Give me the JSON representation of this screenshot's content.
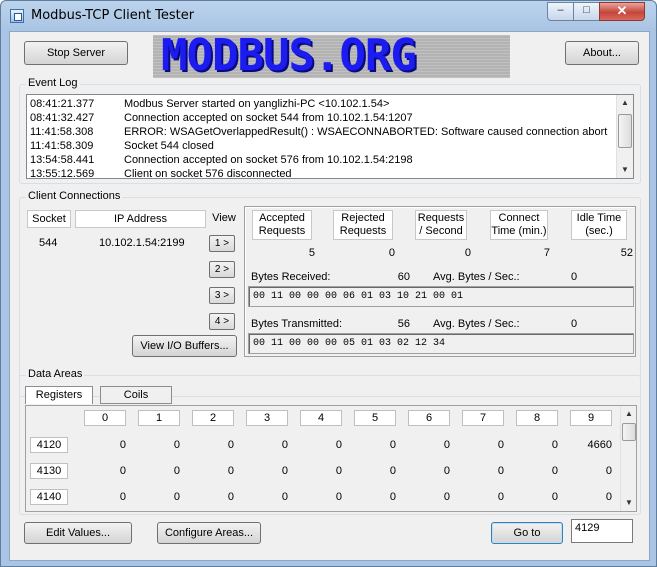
{
  "window": {
    "title": "Modbus-TCP Client Tester",
    "controls": {
      "minimize": "–",
      "maximize": "□",
      "close": "✕"
    }
  },
  "toolbar": {
    "stop_server": "Stop Server",
    "about": "About...",
    "logo_text": "MODBUS.ORG"
  },
  "event_log": {
    "label": "Event Log",
    "entries": [
      {
        "time": "08:41:21.377",
        "message": "Modbus Server started on yanglizhi-PC <10.102.1.54>"
      },
      {
        "time": "08:41:32.427",
        "message": "Connection accepted on socket 544 from 10.102.1.54:1207"
      },
      {
        "time": "11:41:58.308",
        "message": "ERROR: WSAGetOverlappedResult() : WSAECONNABORTED: Software caused connection abort"
      },
      {
        "time": "11:41:58.309",
        "message": "Socket 544 closed"
      },
      {
        "time": "13:54:58.441",
        "message": "Connection accepted on socket 576 from 10.102.1.54:2198"
      },
      {
        "time": "13:55:12.569",
        "message": "Client on socket 576 disconnected"
      }
    ]
  },
  "connections": {
    "label": "Client Connections",
    "socket_header": "Socket",
    "ip_header": "IP Address",
    "view_header": "View",
    "rows": [
      {
        "socket": "544",
        "ip": "10.102.1.54:2199"
      }
    ],
    "view_buttons": [
      "1 >",
      "2 >",
      "3 >",
      "4 >"
    ],
    "view_io_buffers": "View I/O Buffers...",
    "stats_headers": [
      [
        "Accepted",
        "Requests"
      ],
      [
        "Rejected",
        "Requests"
      ],
      [
        "Requests",
        "/ Second"
      ],
      [
        "Connect",
        "Time (min.)"
      ],
      [
        "Idle Time",
        "(sec.)"
      ]
    ],
    "stats_values": [
      "5",
      "0",
      "0",
      "7",
      "52"
    ],
    "bytes_received_label": "Bytes Received:",
    "bytes_received": "60",
    "avg_rx_label": "Avg. Bytes / Sec.:",
    "avg_rx": "0",
    "rx_hex": "00 11 00 00 00 06 01 03 10 21 00 01",
    "bytes_transmitted_label": "Bytes Transmitted:",
    "bytes_transmitted": "56",
    "avg_tx_label": "Avg. Bytes / Sec.:",
    "avg_tx": "0",
    "tx_hex": "00 11 00 00 00 05 01 03 02 12 34"
  },
  "data_areas": {
    "label": "Data Areas",
    "tabs": [
      "Registers",
      "Coils"
    ],
    "columns": [
      "0",
      "1",
      "2",
      "3",
      "4",
      "5",
      "6",
      "7",
      "8",
      "9"
    ],
    "rows": [
      {
        "addr": "4120",
        "values": [
          "0",
          "0",
          "0",
          "0",
          "0",
          "0",
          "0",
          "0",
          "0",
          "4660"
        ]
      },
      {
        "addr": "4130",
        "values": [
          "0",
          "0",
          "0",
          "0",
          "0",
          "0",
          "0",
          "0",
          "0",
          "0"
        ]
      },
      {
        "addr": "4140",
        "values": [
          "0",
          "0",
          "0",
          "0",
          "0",
          "0",
          "0",
          "0",
          "0",
          "0"
        ]
      }
    ]
  },
  "bottom": {
    "edit_values": "Edit Values...",
    "configure_areas": "Configure Areas...",
    "goto": "Go to",
    "goto_value": "4129"
  }
}
